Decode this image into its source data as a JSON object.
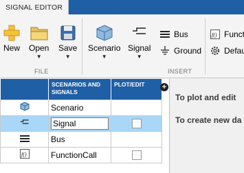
{
  "tab": {
    "title": "SIGNAL EDITOR"
  },
  "toolstrip": {
    "file_group": "FILE",
    "insert_group": "INSERT",
    "buttons": {
      "new": "New",
      "open": "Open",
      "save": "Save",
      "scenario": "Scenario",
      "signal": "Signal",
      "bus": "Bus",
      "ground": "Ground",
      "function_call": "Funct",
      "default": "Defau"
    }
  },
  "table": {
    "headers": {
      "name": "SCENARIOS AND SIGNALS",
      "plot": "PLOT/EDIT"
    },
    "rows": [
      {
        "name": "Scenario",
        "icon": "scenario-icon"
      },
      {
        "name": "Signal",
        "icon": "signal-icon"
      },
      {
        "name": "Bus",
        "icon": "bus-icon"
      },
      {
        "name": "FunctionCall",
        "icon": "function-call-icon"
      }
    ]
  },
  "right_pane": {
    "line1": "To plot and edit",
    "line2": "To create new da"
  },
  "colors": {
    "accent": "#1f5fa6",
    "selection": "#a8d7f8"
  }
}
